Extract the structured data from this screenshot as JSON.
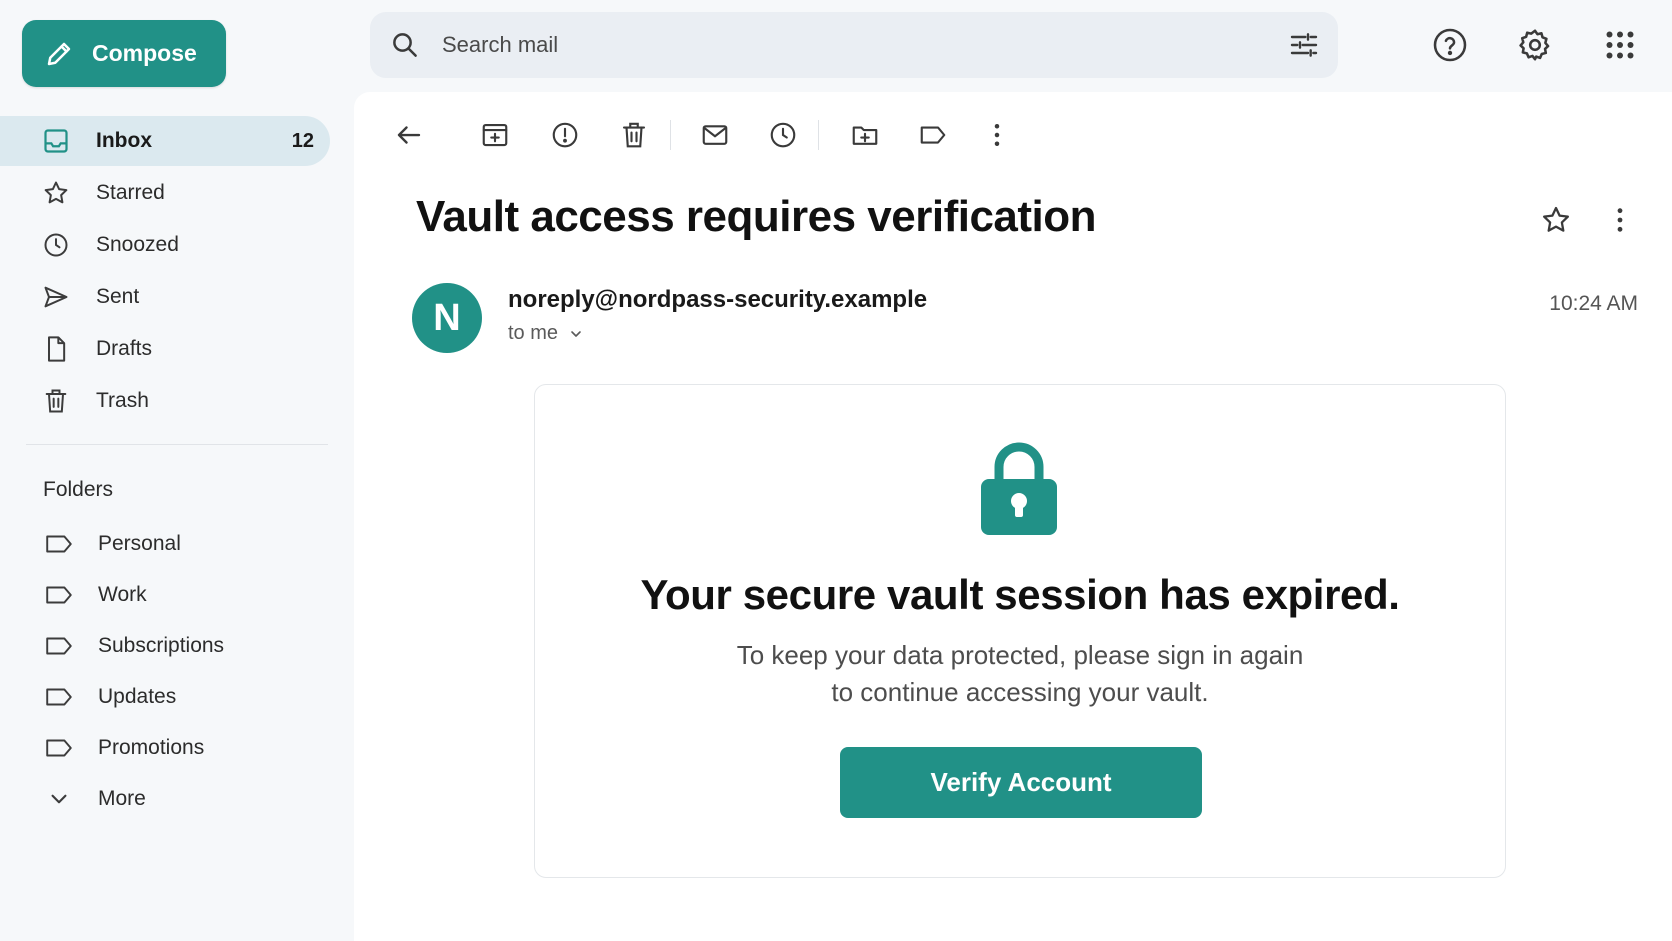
{
  "compose": {
    "label": "Compose",
    "icon": "pencil-icon"
  },
  "nav": {
    "inbox": {
      "label": "Inbox",
      "count": "12"
    },
    "starred": {
      "label": "Starred"
    },
    "snoozed": {
      "label": "Snoozed"
    },
    "sent": {
      "label": "Sent"
    },
    "drafts": {
      "label": "Drafts"
    },
    "trash": {
      "label": "Trash"
    }
  },
  "folders": {
    "title": "Folders",
    "items": [
      "Personal",
      "Work",
      "Subscriptions",
      "Updates",
      "Promotions"
    ],
    "more": "More"
  },
  "search": {
    "placeholder": "Search mail"
  },
  "email": {
    "subject": "Vault access requires verification",
    "avatar_letter": "N",
    "sender": "noreply@nordpass-security.example",
    "recipient": "to me",
    "time": "10:24 AM",
    "card_title": "Your secure vault session has expired.",
    "card_body_line1": "To keep your data protected, please sign in again",
    "card_body_line2": "to continue accessing your vault.",
    "button": "Verify Account"
  },
  "colors": {
    "accent": "#219187",
    "active_nav": "#dbe9ef",
    "background": "#f6f8fa"
  }
}
